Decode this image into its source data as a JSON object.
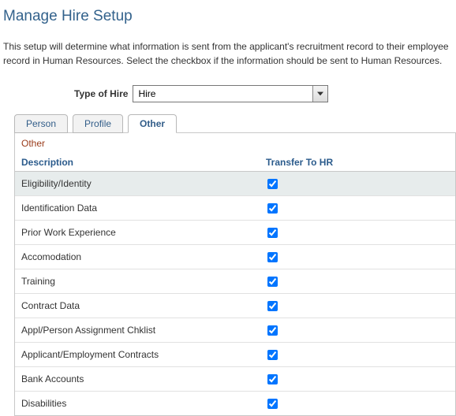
{
  "title": "Manage Hire Setup",
  "intro": "This setup will determine what information is sent from the applicant's recruitment record to their employee record in Human Resources. Select the checkbox if the information should be sent to Human Resources.",
  "typeOfHire": {
    "label": "Type of Hire",
    "value": "Hire"
  },
  "tabs": [
    {
      "label": "Person",
      "active": false
    },
    {
      "label": "Profile",
      "active": false
    },
    {
      "label": "Other",
      "active": true
    }
  ],
  "panel": {
    "title": "Other",
    "headers": {
      "description": "Description",
      "transfer": "Transfer To HR"
    },
    "rows": [
      {
        "description": "Eligibility/Identity",
        "checked": true,
        "alt": true
      },
      {
        "description": "Identification Data",
        "checked": true,
        "alt": false
      },
      {
        "description": "Prior Work Experience",
        "checked": true,
        "alt": false
      },
      {
        "description": "Accomodation",
        "checked": true,
        "alt": false
      },
      {
        "description": "Training",
        "checked": true,
        "alt": false
      },
      {
        "description": "Contract Data",
        "checked": true,
        "alt": false
      },
      {
        "description": "Appl/Person Assignment Chklist",
        "checked": true,
        "alt": false
      },
      {
        "description": "Applicant/Employment Contracts",
        "checked": true,
        "alt": false
      },
      {
        "description": "Bank Accounts",
        "checked": true,
        "alt": false
      },
      {
        "description": "Disabilities",
        "checked": true,
        "alt": false
      }
    ]
  }
}
